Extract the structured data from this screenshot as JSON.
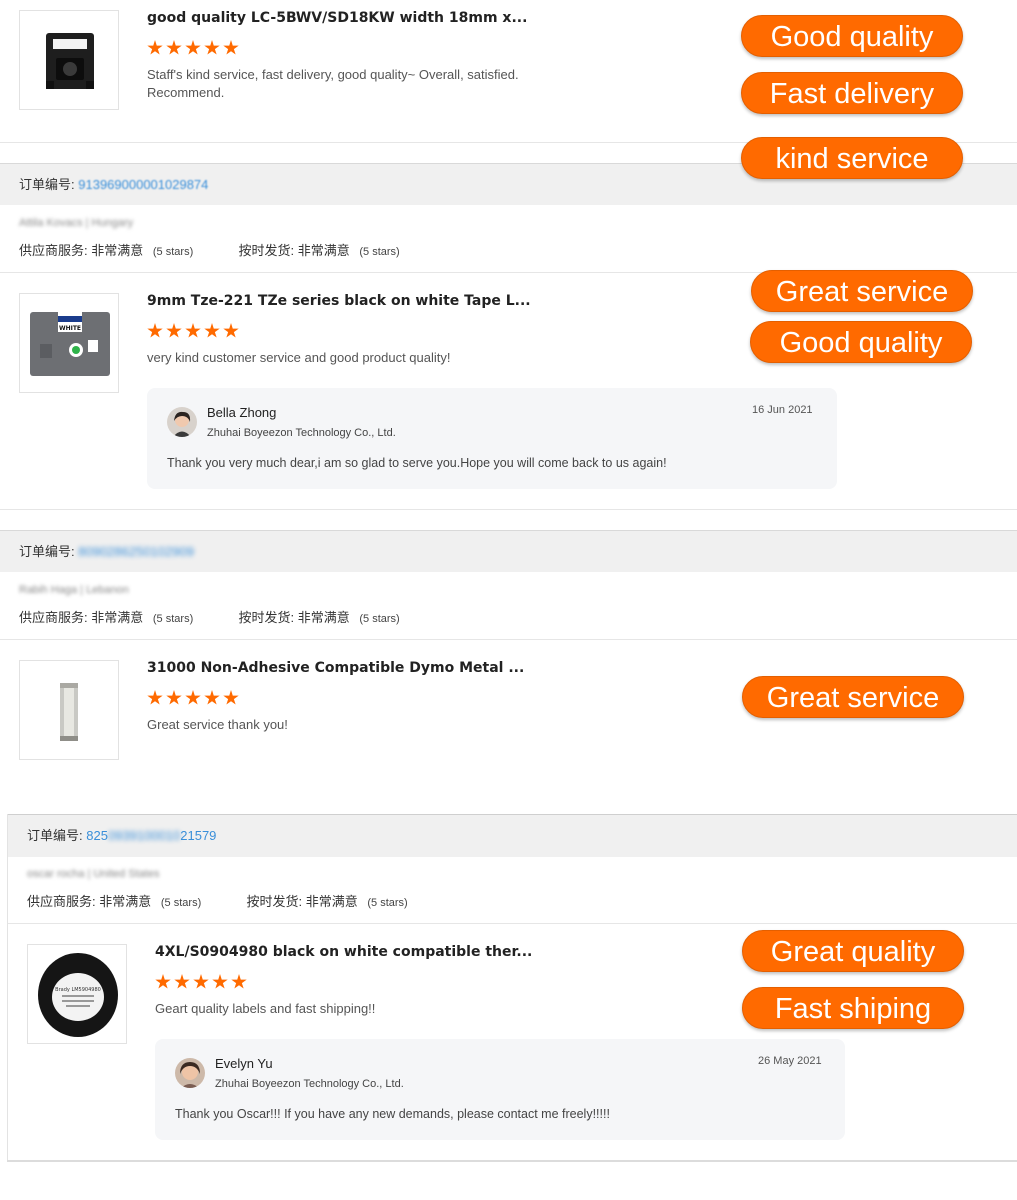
{
  "reviews": [
    {
      "title": "good quality LC-5BWV/SD18KW width 18mm x...",
      "comment_line1": "Staff's kind service, fast delivery, good quality~ Overall, satisfied.",
      "comment_line2": "Recommend."
    },
    {
      "order_label": "订单编号:",
      "order_number": "913969000001029874",
      "buyer": "Attila Kovacs | Hungary",
      "supplier_service_label": "供应商服务:",
      "supplier_service_value": "非常满意",
      "supplier_service_stars": "(5 stars)",
      "ontime_label": "按时发货:",
      "ontime_value": "非常满意",
      "ontime_stars": "(5 stars)",
      "title": "9mm Tze-221 TZe series black on white Tape L...",
      "comment": "very kind customer service and good product quality!",
      "reply": {
        "name": "Bella Zhong",
        "company": "Zhuhai Boyeezon Technology Co., Ltd.",
        "date": "16 Jun 2021",
        "text": "Thank you very much dear,i am so glad to serve you.Hope you will come back to us again!"
      }
    },
    {
      "order_label": "订单编号:",
      "order_number": "8090286250102909",
      "buyer": "Rabih Haga | Lebanon",
      "supplier_service_label": "供应商服务:",
      "supplier_service_value": "非常满意",
      "supplier_service_stars": "(5 stars)",
      "ontime_label": "按时发货:",
      "ontime_value": "非常满意",
      "ontime_stars": "(5 stars)",
      "title": "31000 Non-Adhesive Compatible Dymo Metal ...",
      "comment": "Great service thank you!"
    },
    {
      "order_label": "订单编号:",
      "order_number_start": "825",
      "order_number_mid": "0939100010",
      "order_number_end": "21579",
      "buyer": "oscar rocha | United States",
      "supplier_service_label": "供应商服务:",
      "supplier_service_value": "非常满意",
      "supplier_service_stars": "(5 stars)",
      "ontime_label": "按时发货:",
      "ontime_value": "非常满意",
      "ontime_stars": "(5 stars)",
      "title": "4XL/S0904980 black on white compatible ther...",
      "comment": "Geart quality labels and fast shipping!!",
      "reply": {
        "name": "Evelyn Yu",
        "company": "Zhuhai Boyeezon Technology Co., Ltd.",
        "date": "26 May 2021",
        "text": "Thank you Oscar!!!  If you have any new demands, please contact me freely!!!!!"
      }
    }
  ],
  "tags": {
    "t1": "Good quality",
    "t2": "Fast delivery",
    "t3": "kind service",
    "t4": "Great service",
    "t5": "Good quality",
    "t6": "Great service",
    "t7": "Great quality",
    "t8": "Fast shiping"
  },
  "thumb_texts": {
    "tze": "WHITE",
    "roll": "Brady LM5904980"
  },
  "colors": {
    "accent": "#ff6a00",
    "link": "#3a8fd9",
    "reply_bg": "#f5f6f8",
    "bar_bg": "#f0f0f0"
  }
}
